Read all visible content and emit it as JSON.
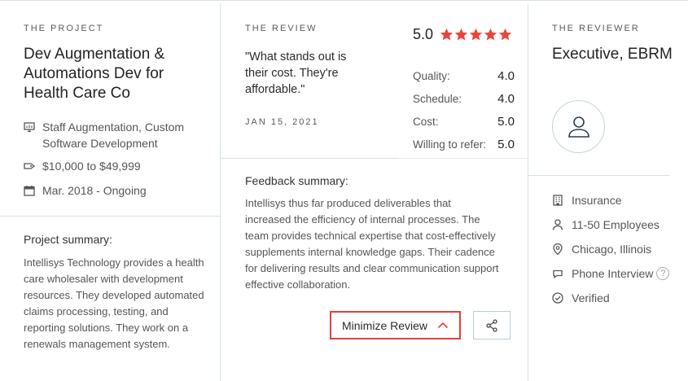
{
  "project": {
    "eyebrow": "THE PROJECT",
    "title": "Dev Augmentation & Automations Dev for Health Care Co",
    "service": "Staff Augmentation, Custom Software Development",
    "budget": "$10,000 to $49,999",
    "dates": "Mar. 2018 - Ongoing",
    "summary_label": "Project summary:",
    "summary_text": "Intellisys Technology provides a health care wholesaler with development resources. They developed automated claims processing, testing, and reporting solutions. They work on a renewals management system."
  },
  "review": {
    "eyebrow": "THE REVIEW",
    "quote": "\"What stands out is their cost. They're affordable.\"",
    "date": "JAN 15, 2021",
    "overall": "5.0",
    "star_count": 5,
    "star_color": "#e8453c",
    "scores": [
      {
        "label": "Quality:",
        "value": "4.0"
      },
      {
        "label": "Schedule:",
        "value": "4.0"
      },
      {
        "label": "Cost:",
        "value": "5.0"
      },
      {
        "label": "Willing to refer:",
        "value": "5.0"
      }
    ],
    "feedback_label": "Feedback summary:",
    "feedback_text": "Intellisys thus far produced deliverables that increased the efficiency of internal processes. The team provides technical expertise that cost-effectively supplements internal knowledge gaps. Their cadence for delivering results and clear communication support effective collaboration.",
    "minimize_label": "Minimize Review",
    "accent_color": "#e0413d"
  },
  "reviewer": {
    "eyebrow": "THE REVIEWER",
    "title": "Executive, EBRM",
    "industry": "Insurance",
    "size": "11-50 Employees",
    "location": "Chicago, Illinois",
    "interview": "Phone Interview",
    "help": "?",
    "verified": "Verified"
  },
  "icons": [
    "monitor-icon",
    "price-tag-icon",
    "calendar-icon",
    "chevron-up-icon",
    "share-icon",
    "user-avatar-icon",
    "building-icon",
    "person-icon",
    "location-pin-icon",
    "chat-bubble-icon",
    "check-circle-icon",
    "star-icon",
    "help-icon"
  ]
}
